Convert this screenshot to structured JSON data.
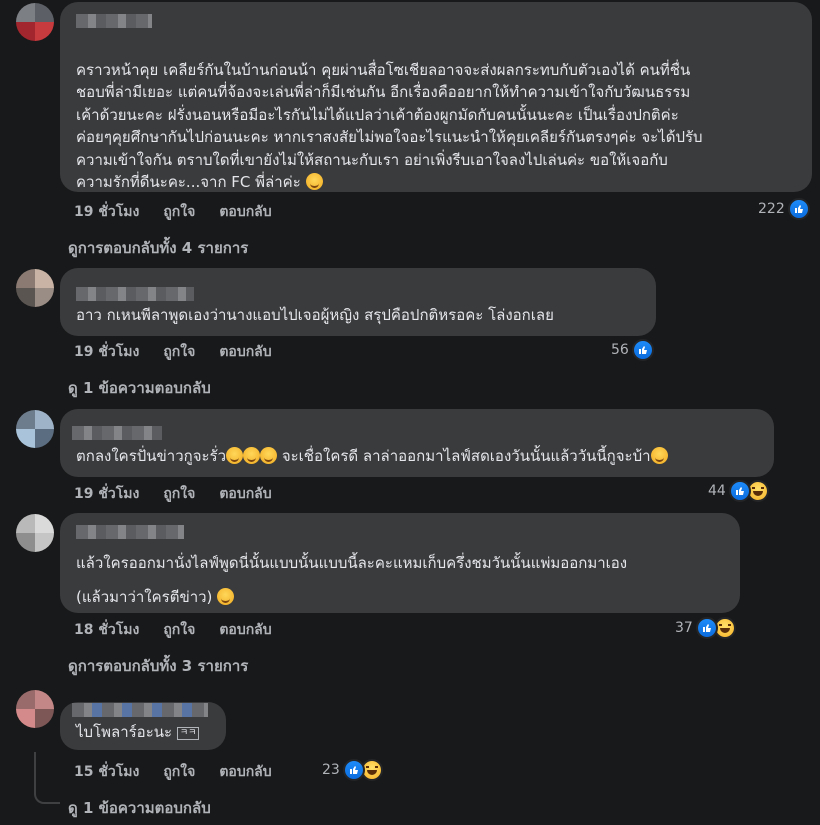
{
  "comments": [
    {
      "text_lines": [
        "คราวหน้าคุย เคลียร์กันในบ้านก่อนน้า คุยผ่านสื่อโซเชียลอาจจะส่งผลกระทบกับตัวเองได้ คนที่ชื่น",
        "ชอบพี่ล่ามีเยอะ แต่คนที่จ้องจะเล่นพี่ล่าก็มีเช่นกัน อีกเรื่องคืออยากให้ทำความเข้าใจกับวัฒนธรรม",
        "เค้าด้วยนะคะ ฝรั่งนอนหรือมีอะไรกันไม่ได้แปลว่าเค้าต้องผูกมัดกับคนนั้นนะคะ เป็นเรื่องปกติค่ะ",
        "ค่อยๆคุยศึกษากันไปก่อนนะคะ หากเราสงสัยไม่พอใจอะไรแนะนำให้คุยเคลียร์กันตรงๆค่ะ จะได้ปรับ",
        "ความเข้าใจกัน ตราบใดที่เขายังไม่ให้สถานะกับเรา อย่าเพิ่งรีบเอาใจลงไปเล่นค่ะ ขอให้เจอกับ",
        "ความรักที่ดีนะคะ...จาก FC พี่ล่าค่ะ"
      ],
      "time": "19 ชั่วโมง",
      "like": "ถูกใจ",
      "reply": "ตอบกลับ",
      "reaction_count": "222",
      "view_replies": "ดูการตอบกลับทั้ง 4 รายการ"
    },
    {
      "text_lines": [
        "อาว กเหนพีลาพูดเองว่านางแอบไปเจอผู้หญิง สรุปคือปกติหรอคะ โล่งอกเลย"
      ],
      "time": "19 ชั่วโมง",
      "like": "ถูกใจ",
      "reply": "ตอบกลับ",
      "reaction_count": "56",
      "view_replies": "ดู 1 ข้อความตอบกลับ"
    },
    {
      "text_lines": [
        "ตกลงใครปั่นข่าวกูจะรั่ว",
        "จะเชื่อใครดี ลาล่าออกมาไลฟ์สดเองวันนั้นแล้ววันนี้กูจะบ้า"
      ],
      "time": "19 ชั่วโมง",
      "like": "ถูกใจ",
      "reply": "ตอบกลับ",
      "reaction_count": "44"
    },
    {
      "text_lines": [
        "แล้วใครออกมานั่งไลฟ์พูดนี่นั้นแบบนั้นแบบนี้ละคะแหมเก็บครึ่งชมวันนั้นแพ่มออกมาเอง",
        "(แล้วมาว่าใครตีข่าว)"
      ],
      "time": "18 ชั่วโมง",
      "like": "ถูกใจ",
      "reply": "ตอบกลับ",
      "reaction_count": "37",
      "view_replies": "ดูการตอบกลับทั้ง 3 รายการ"
    },
    {
      "text_lines": [
        "ไบโพลาร์อะนะ"
      ],
      "badge": "ㅋㅋ",
      "time": "15 ชั่วโมง",
      "like": "ถูกใจ",
      "reply": "ตอบกลับ",
      "reaction_count": "23",
      "view_replies": "ดู 1 ข้อความตอบกลับ"
    }
  ],
  "colors": {
    "background": "#18191a",
    "bubble": "#3a3b3c",
    "text": "#e4e6eb",
    "secondary": "#b0b3b8",
    "like_blue": "#1877f2"
  },
  "icons": [
    "like-icon",
    "haha-icon",
    "smile-emoji"
  ]
}
